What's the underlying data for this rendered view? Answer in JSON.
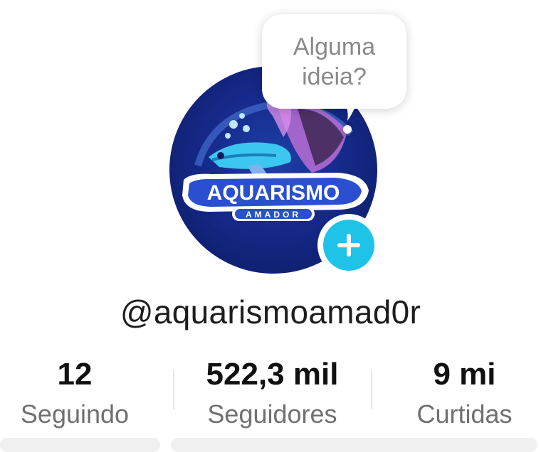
{
  "profile": {
    "bubble_text": "Alguma ideia?",
    "username": "@aquarismoamad0r",
    "avatar": {
      "logo_word": "AQUARISMO",
      "logo_sub": "AMADOR"
    }
  },
  "stats": [
    {
      "value": "12",
      "label": "Seguindo"
    },
    {
      "value": "522,3 mil",
      "label": "Seguidores"
    },
    {
      "value": "9 mi",
      "label": "Curtidas"
    }
  ],
  "colors": {
    "add_button": "#20c3e8",
    "avatar_bg": "#15298a",
    "label_gray": "#707070"
  },
  "icons": {
    "add": "plus-icon"
  }
}
